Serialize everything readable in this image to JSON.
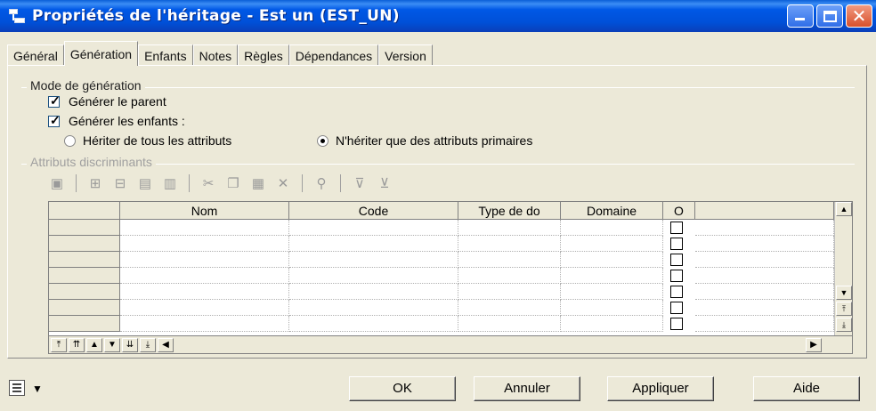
{
  "window": {
    "title": "Propriétés de l'héritage - Est un (EST_UN)"
  },
  "tabs": [
    {
      "label": "Général"
    },
    {
      "label": "Génération",
      "active": true
    },
    {
      "label": "Enfants"
    },
    {
      "label": "Notes"
    },
    {
      "label": "Règles"
    },
    {
      "label": "Dépendances"
    },
    {
      "label": "Version"
    }
  ],
  "mode_generation": {
    "group_label": "Mode de génération",
    "generer_parent": {
      "label": "Générer le parent",
      "checked": true
    },
    "generer_enfants": {
      "label": "Générer les enfants :",
      "checked": true
    },
    "radio_tous": {
      "label": "Hériter de tous les attributs",
      "selected": false
    },
    "radio_primaires": {
      "label": "N'hériter que des attributs primaires",
      "selected": true
    }
  },
  "attributs": {
    "group_label": "Attributs discriminants",
    "toolbar_icons": [
      "properties-icon",
      "add-row-icon",
      "insert-row-icon",
      "add-attributes-icon",
      "reuse-attributes-icon",
      "cut-icon",
      "copy-icon",
      "paste-icon",
      "delete-icon",
      "find-icon",
      "filter-icon",
      "clear-filter-icon"
    ],
    "columns": [
      "Nom",
      "Code",
      "Type de do",
      "Domaine",
      "O"
    ],
    "row_count": 7
  },
  "buttons": {
    "ok": "OK",
    "annuler": "Annuler",
    "appliquer": "Appliquer",
    "aide": "Aide"
  }
}
